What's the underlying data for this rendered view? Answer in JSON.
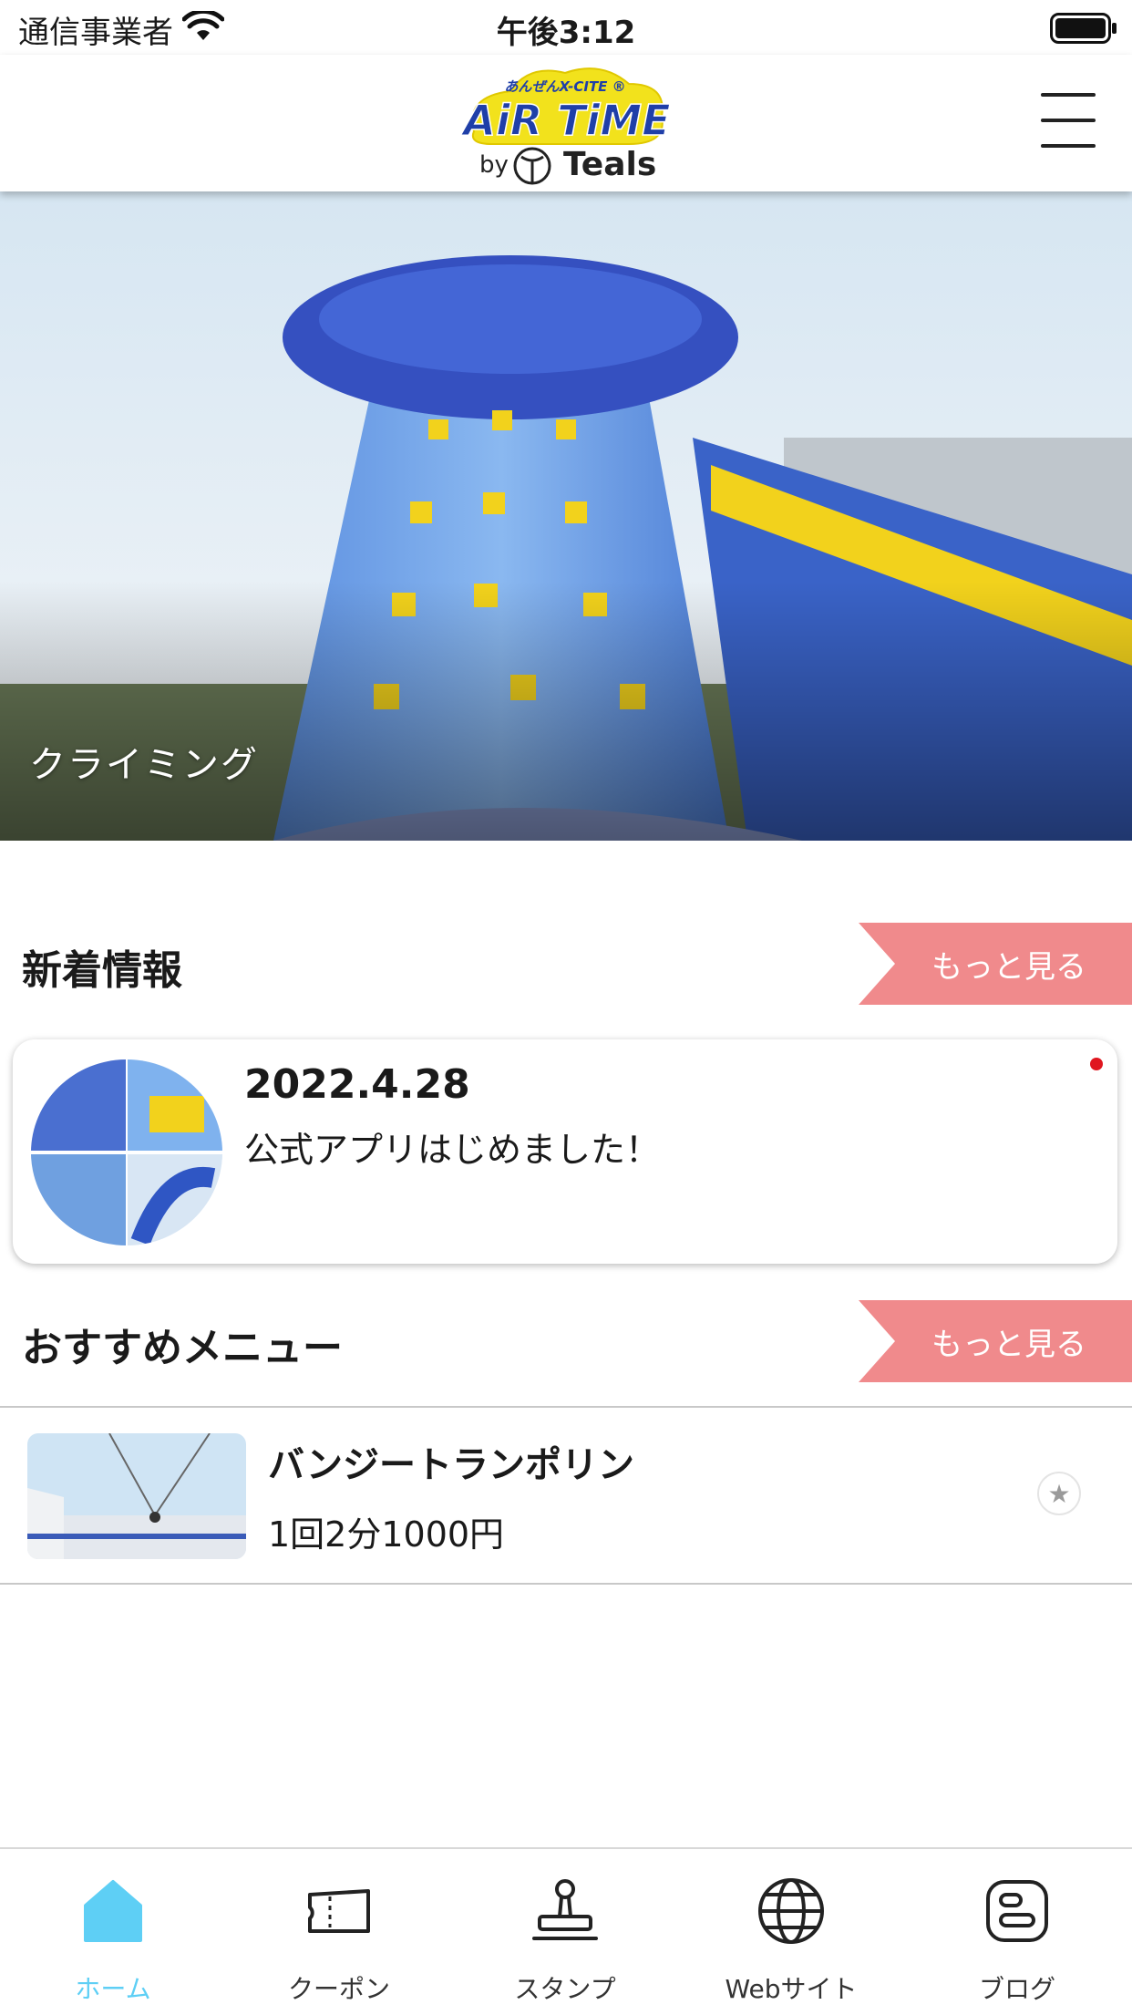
{
  "status_bar": {
    "carrier": "通信事業者",
    "time": "午後3:12"
  },
  "header": {
    "logo_top": "あんぜんX-CITE ®",
    "logo_main": "AiR TiME",
    "logo_by": "by",
    "logo_brand": "Teals"
  },
  "hero": {
    "caption": "クライミング"
  },
  "news": {
    "title": "新着情報",
    "more_label": "もっと見る",
    "items": [
      {
        "date": "2022.4.28",
        "text": "公式アプリはじめました！",
        "unread": true
      }
    ]
  },
  "recommended": {
    "title": "おすすめメニュー",
    "more_label": "もっと見る",
    "items": [
      {
        "name": "バンジートランポリン",
        "price": "1回2分1000円"
      }
    ]
  },
  "tabs": [
    {
      "label": "ホーム",
      "icon": "home-icon",
      "active": true
    },
    {
      "label": "クーポン",
      "icon": "ticket-icon",
      "active": false
    },
    {
      "label": "スタンプ",
      "icon": "stamp-icon",
      "active": false
    },
    {
      "label": "Webサイト",
      "icon": "globe-icon",
      "active": false
    },
    {
      "label": "ブログ",
      "icon": "blog-icon",
      "active": false
    }
  ],
  "colors": {
    "accent": "#5ecff5",
    "more_button": "#f08a8c",
    "unread": "#e0161f",
    "logo_yellow": "#f2e21c",
    "logo_blue": "#1f3fa8"
  }
}
